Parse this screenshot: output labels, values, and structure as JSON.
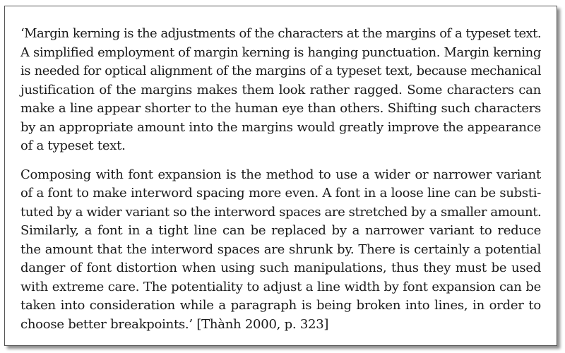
{
  "quote": {
    "paragraphs": [
      {
        "lines": [
          "‘Margin kerning is the adjustments of the characters at the margins of a typeset text.",
          "A simplified employment of margin kerning is hanging punctuation. Margin kerning",
          "is needed for optical alignment of the margins of a typeset text, because mechanical",
          "justification of the margins makes them look rather ragged. Some characters can",
          "make a line appear shorter to the human eye than others. Shifting such characters",
          "by an appropriate amount into the margins would greatly improve the appearance",
          "of a typeset text."
        ]
      },
      {
        "lines": [
          "Composing with font expansion is the method to use a wider or narrower variant",
          "of a font to make interword spacing more even. A font in a loose line can be substi-",
          "tuted by a wider variant so the interword spaces are stretched by a smaller amount.",
          "Similarly, a font in a tight line can be replaced by a narrower variant to reduce",
          "the amount that the interword spaces are shrunk by. There is certainly a potential",
          "danger of font distortion when using such manipulations, thus they must be used",
          "with extreme care. The potentiality to adjust a line width by font expansion can be",
          "taken into consideration while a paragraph is being broken into lines, in order to",
          "choose better breakpoints.’ [Thành 2000, p. 323]"
        ]
      }
    ]
  }
}
